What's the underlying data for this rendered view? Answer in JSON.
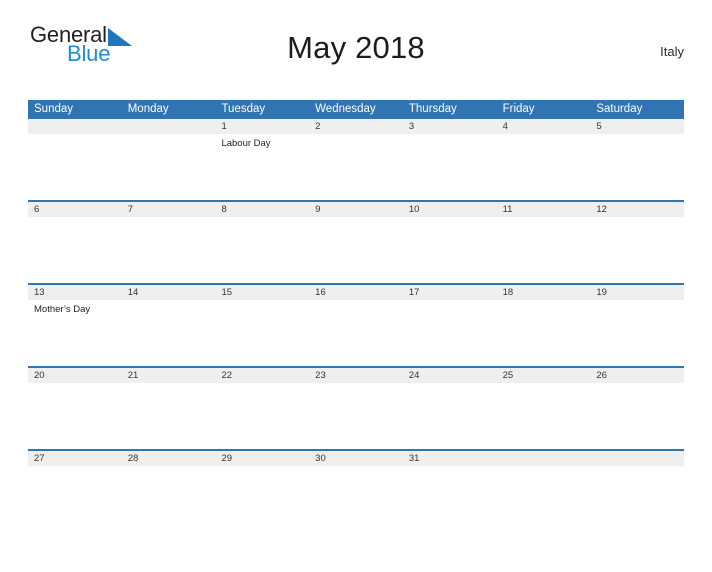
{
  "logo": {
    "word1": "General",
    "word2": "Blue",
    "mark": "triangle-flag",
    "color_dark": "#231f20",
    "color_blue": "#1f8ad6",
    "color_mark": "#1f76bc"
  },
  "header": {
    "title": "May 2018",
    "country": "Italy"
  },
  "theme": {
    "header_blue": "#3074b4",
    "band_gray": "#efefef",
    "text_dark": "#333333"
  },
  "calendar": {
    "weekdays": [
      "Sunday",
      "Monday",
      "Tuesday",
      "Wednesday",
      "Thursday",
      "Friday",
      "Saturday"
    ],
    "weeks": [
      {
        "dates": [
          "",
          "",
          "1",
          "2",
          "3",
          "4",
          "5"
        ],
        "events": [
          "",
          "",
          "Labour Day",
          "",
          "",
          "",
          ""
        ]
      },
      {
        "dates": [
          "6",
          "7",
          "8",
          "9",
          "10",
          "11",
          "12"
        ],
        "events": [
          "",
          "",
          "",
          "",
          "",
          "",
          ""
        ]
      },
      {
        "dates": [
          "13",
          "14",
          "15",
          "16",
          "17",
          "18",
          "19"
        ],
        "events": [
          "Mother’s Day",
          "",
          "",
          "",
          "",
          "",
          ""
        ]
      },
      {
        "dates": [
          "20",
          "21",
          "22",
          "23",
          "24",
          "25",
          "26"
        ],
        "events": [
          "",
          "",
          "",
          "",
          "",
          "",
          ""
        ]
      },
      {
        "dates": [
          "27",
          "28",
          "29",
          "30",
          "31",
          "",
          ""
        ],
        "events": [
          "",
          "",
          "",
          "",
          "",
          "",
          ""
        ]
      }
    ]
  }
}
